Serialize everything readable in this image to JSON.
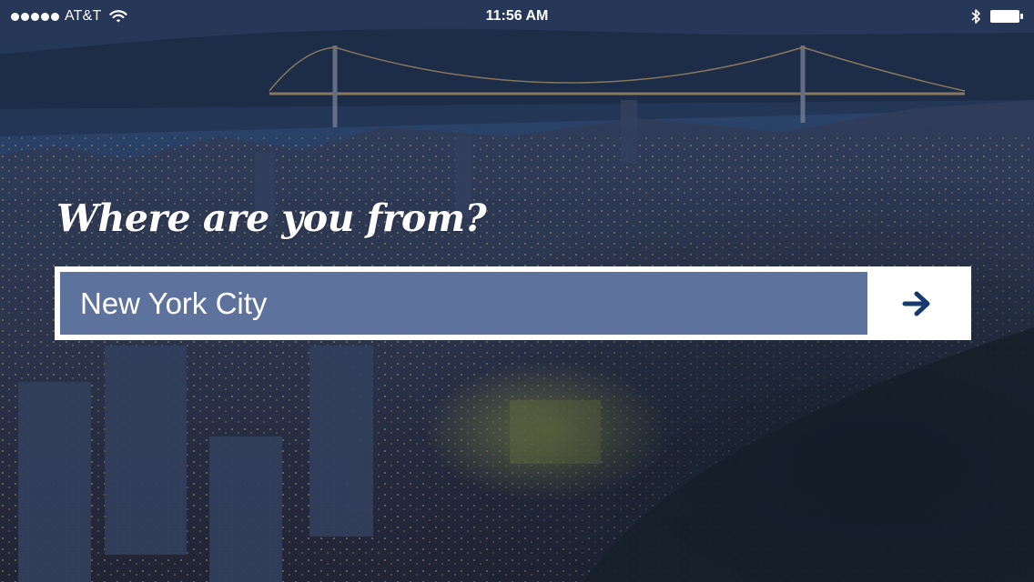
{
  "status_bar": {
    "carrier": "AT&T",
    "time": "11:56 AM",
    "signal_icon": "signal-dots-icon",
    "wifi_icon": "wifi-icon",
    "bluetooth_icon": "bluetooth-icon",
    "battery_icon": "battery-icon",
    "battery_level": 1.0
  },
  "prompt": {
    "title": "Where are you from?"
  },
  "location_input": {
    "value": "New York City",
    "submit_icon": "arrow-right-icon"
  },
  "colors": {
    "overlay": "#1c2d4e",
    "input_fill": "#1e3c76",
    "accent": "#173a6e",
    "text": "#ffffff"
  }
}
